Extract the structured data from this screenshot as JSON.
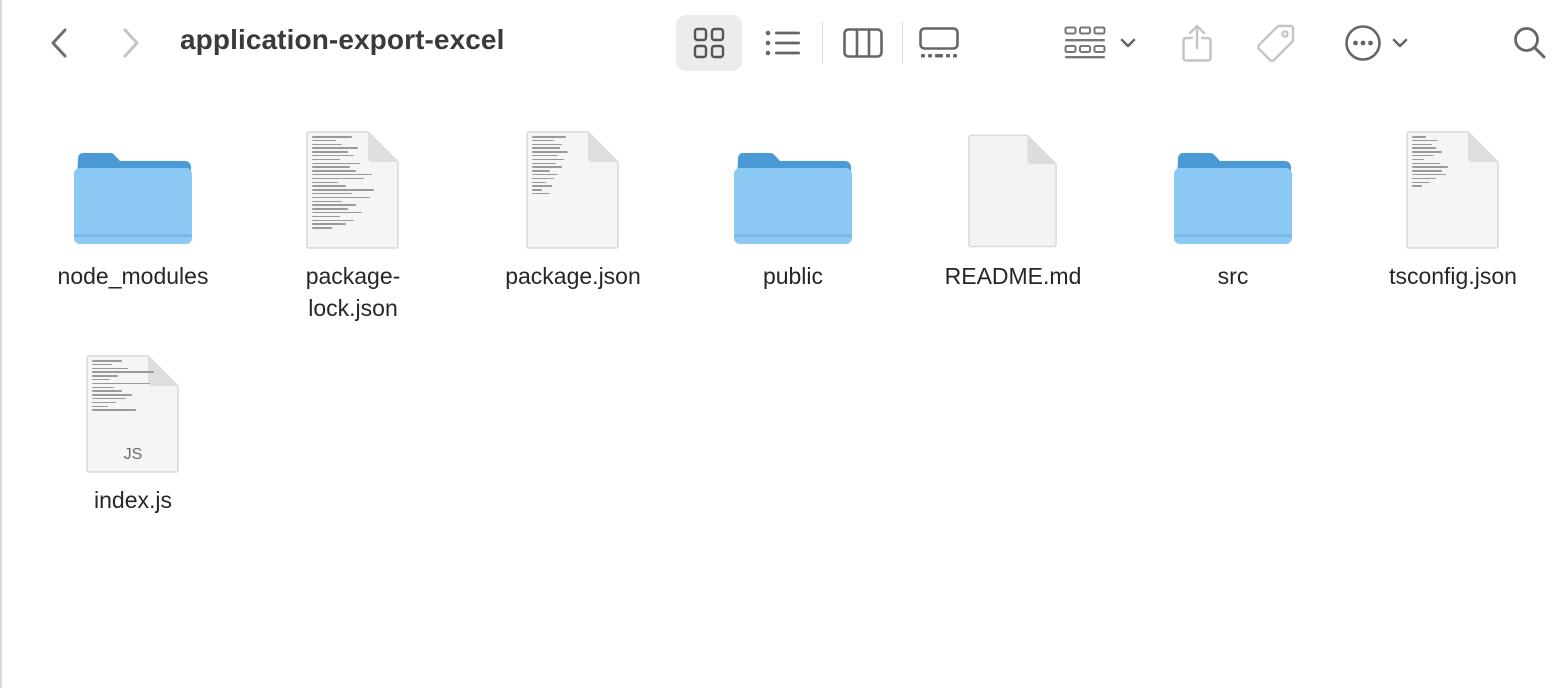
{
  "window": {
    "title": "application-export-excel"
  },
  "toolbar": {
    "back": {
      "icon": "chevron-left-icon",
      "enabled": true
    },
    "forward": {
      "icon": "chevron-right-icon",
      "enabled": false
    },
    "views": [
      {
        "name": "icon-view",
        "icon": "grid-icon",
        "selected": true
      },
      {
        "name": "list-view",
        "icon": "list-icon",
        "selected": false
      },
      {
        "name": "column-view",
        "icon": "columns-icon",
        "selected": false
      },
      {
        "name": "gallery-view",
        "icon": "gallery-icon",
        "selected": false
      }
    ],
    "group_menu": {
      "icon": "group-grid-icon",
      "has_dropdown": true
    },
    "share": {
      "icon": "share-icon",
      "enabled": false
    },
    "tags": {
      "icon": "tag-icon",
      "enabled": false
    },
    "more": {
      "icon": "ellipsis-circle-icon",
      "has_dropdown": true
    },
    "search": {
      "icon": "search-icon"
    }
  },
  "files": [
    {
      "name": "node_modules",
      "kind": "folder"
    },
    {
      "name": "package-\nlock.json",
      "kind": "document"
    },
    {
      "name": "package.json",
      "kind": "document"
    },
    {
      "name": "public",
      "kind": "folder"
    },
    {
      "name": "README.md",
      "kind": "document-blank"
    },
    {
      "name": "src",
      "kind": "folder"
    },
    {
      "name": "tsconfig.json",
      "kind": "document"
    },
    {
      "name": "index.js",
      "kind": "document-js",
      "badge": "JS"
    }
  ],
  "colors": {
    "folder_back": "#4a9ad6",
    "folder_front": "#8cc8f4",
    "icon_gray": "#7b7b7b",
    "icon_disabled": "#c4c4c4",
    "selected_view_bg": "#ececec"
  }
}
